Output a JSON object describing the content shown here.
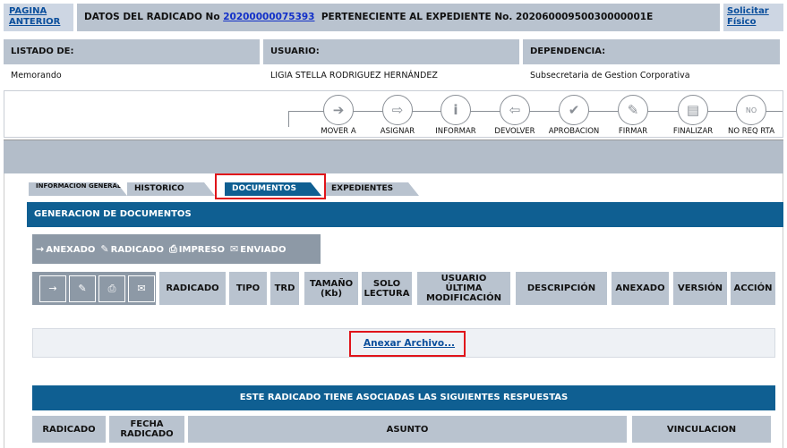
{
  "header": {
    "back_link": "PAGINA ANTERIOR",
    "title_prefix": "DATOS DEL RADICADO No",
    "radicado": "20200000075393",
    "title_suffix": "PERTENECIENTE AL EXPEDIENTE No. 20206000950030000001E",
    "fisico_link": "Solicitar Físico"
  },
  "info": {
    "listado_label": "LISTADO DE:",
    "listado_value": "Memorando",
    "usuario_label": "USUARIO:",
    "usuario_value": "LIGIA STELLA RODRIGUEZ HERNÁNDEZ",
    "dependencia_label": "DEPENDENCIA:",
    "dependencia_value": "Subsecretaria de Gestion Corporativa"
  },
  "actions": [
    {
      "label": "MOVER A",
      "icon": "arrow-right-icon"
    },
    {
      "label": "ASIGNAR",
      "icon": "assign-icon"
    },
    {
      "label": "INFORMAR",
      "icon": "info-icon"
    },
    {
      "label": "DEVOLVER",
      "icon": "return-icon"
    },
    {
      "label": "APROBACION",
      "icon": "check-icon"
    },
    {
      "label": "FIRMAR",
      "icon": "sign-icon"
    },
    {
      "label": "FINALIZAR",
      "icon": "finish-icon"
    },
    {
      "label": "NO REQ RTA",
      "icon": "no-response-icon"
    }
  ],
  "tabs": {
    "info": "INFORMACION GENERAL",
    "historico": "HISTORICO",
    "documentos": "DOCUMENTOS",
    "expedientes": "EXPEDIENTES"
  },
  "docs": {
    "title": "GENERACION DE DOCUMENTOS",
    "legend": {
      "anexado": "ANEXADO",
      "radicado": "RADICADO",
      "impreso": "IMPRESO",
      "enviado": "ENVIADO"
    },
    "columns": {
      "radicado": "RADICADO",
      "tipo": "TIPO",
      "trd": "TRD",
      "tamano": "TAMAÑO (Kb)",
      "solo_lectura": "SOLO LECTURA",
      "usuario_mod": "USUARIO ÚLTIMA MODIFICACIÓN",
      "descripcion": "DESCRIPCIÓN",
      "anexado": "ANEXADO",
      "version": "VERSIÓN",
      "accion": "ACCIÓN"
    },
    "anexar_link": "Anexar Archivo..."
  },
  "respuestas": {
    "title": "ESTE RADICADO TIENE ASOCIADAS LAS SIGUIENTES RESPUESTAS",
    "columns": {
      "radicado": "RADICADO",
      "fecha": "FECHA RADICADO",
      "asunto": "ASUNTO",
      "vinculacion": "VINCULACION"
    }
  },
  "colors": {
    "accent_blue": "#0f5f92",
    "header_gray": "#b9c3cf",
    "highlight_red": "#e0141a"
  }
}
